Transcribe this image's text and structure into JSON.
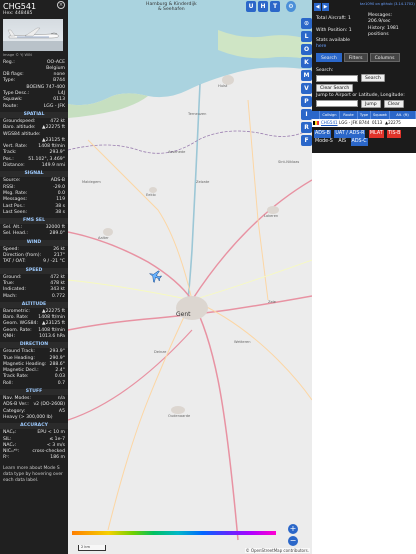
{
  "info": {
    "callsign": "CHG541",
    "hex_label": "Hex: 448485",
    "close": "×",
    "photo_credit": "Image © YJ WIN",
    "id_rows": [
      {
        "k": "Reg.:",
        "v": "OO-ACE"
      },
      {
        "k": "",
        "v": "Belgium"
      },
      {
        "k": "DB flags:",
        "v": "none"
      },
      {
        "k": "Type:",
        "v": "B744"
      },
      {
        "k": "",
        "v": "BOEING 747-400"
      },
      {
        "k": "Type Desc.:",
        "v": "L4J"
      },
      {
        "k": "Squawk:",
        "v": "0113"
      },
      {
        "k": "Route:",
        "v": "LGG - JFK"
      }
    ],
    "sections": [
      {
        "title": "SPATIAL",
        "rows": [
          {
            "k": "Groundspeed:",
            "v": "472 kt"
          },
          {
            "k": "Baro. altitude:",
            "v": "▲22275 ft"
          },
          {
            "k": "WGS84 altitude:",
            "v": ""
          },
          {
            "k": "",
            "v": "▲23125 ft"
          },
          {
            "k": "Vert. Rate:",
            "v": "1408 ft/min"
          },
          {
            "k": "Track:",
            "v": "293.9°"
          },
          {
            "k": "Pos.:",
            "v": "51.102°, 3.469°"
          },
          {
            "k": "Distance:",
            "v": "149.9 nmi"
          }
        ]
      },
      {
        "title": "SIGNAL",
        "rows": [
          {
            "k": "Source:",
            "v": "ADS-B"
          },
          {
            "k": "RSSI:",
            "v": "-29.0"
          },
          {
            "k": "Msg. Rate:",
            "v": "0.0"
          },
          {
            "k": "Messages:",
            "v": "119"
          },
          {
            "k": "Last Pos.:",
            "v": "38 s"
          },
          {
            "k": "Last Seen:",
            "v": "38 s"
          }
        ]
      },
      {
        "title": "FMS SEL",
        "rows": [
          {
            "k": "Sel. Alt.:",
            "v": "32000 ft"
          },
          {
            "k": "Sel. Head.:",
            "v": "289.0°"
          }
        ]
      },
      {
        "title": "WIND",
        "rows": [
          {
            "k": "Speed:",
            "v": "26 kt"
          },
          {
            "k": "Direction (from):",
            "v": "217°"
          },
          {
            "k": "TAT / OAT:",
            "v": "9 / -21 °C"
          }
        ]
      },
      {
        "title": "SPEED",
        "rows": [
          {
            "k": "Ground:",
            "v": "472 kt"
          },
          {
            "k": "True:",
            "v": "478 kt"
          },
          {
            "k": "Indicated:",
            "v": "343 kt"
          },
          {
            "k": "Mach:",
            "v": "0.772"
          }
        ]
      },
      {
        "title": "ALTITUDE",
        "rows": [
          {
            "k": "Barometric:",
            "v": "▲22275 ft"
          },
          {
            "k": "Baro. Rate:",
            "v": "1408 ft/min"
          },
          {
            "k": "Geom. WGS84:",
            "v": "▲23125 ft"
          },
          {
            "k": "Geom. Rate:",
            "v": "1408 ft/min"
          },
          {
            "k": "QNH:",
            "v": "1013.6 hPa"
          }
        ]
      },
      {
        "title": "DIRECTION",
        "rows": [
          {
            "k": "Ground Track:",
            "v": "293.9°"
          },
          {
            "k": "True Heading:",
            "v": "290.9°"
          },
          {
            "k": "Magnetic Heading:",
            "v": "288.6°"
          },
          {
            "k": "Magnetic Decl.:",
            "v": "2.4°"
          },
          {
            "k": "Track Rate:",
            "v": "0.03"
          },
          {
            "k": "Roll:",
            "v": "0.7"
          }
        ]
      },
      {
        "title": "STUFF",
        "rows": [
          {
            "k": "Nav. Modes:",
            "v": "n/a"
          },
          {
            "k": "ADS-B Ver.:",
            "v": "v2 (DO-260B)"
          },
          {
            "k": "Category:",
            "v": "A5"
          },
          {
            "k": "Heavy (> 300,000 lb)",
            "v": ""
          }
        ]
      },
      {
        "title": "ACCURACY",
        "rows": [
          {
            "k": "NACₚ:",
            "v": "EPU < 10 m"
          },
          {
            "k": "SIL:",
            "v": "≤ 1e-7"
          },
          {
            "k": "NACᵥ:",
            "v": "< 3 m/s"
          },
          {
            "k": "NICₒᵢᵉᵇ:",
            "v": "cross-checked"
          },
          {
            "k": "Rᶜ:",
            "v": "186 m"
          }
        ]
      }
    ],
    "note": "Learn more about Mode S data type by hovering over each data label."
  },
  "map": {
    "top_label_line1": "Hamburg & Kinderdijk",
    "top_label_line2": "& Seehafen",
    "layer_buttons": [
      "U",
      "H",
      "T"
    ],
    "side_buttons": [
      "⊙",
      "L",
      "O",
      "K",
      "M",
      "V",
      "P",
      "I",
      "R",
      "F"
    ],
    "cities": [
      "Gent",
      "Aalter",
      "Eeklo",
      "Lokeren",
      "Deinze",
      "Oudenaarde",
      "Hulst",
      "Terneuzen",
      "Sint-Niklaas",
      "Zelzate",
      "Wetteren",
      "Zele",
      "Assenede",
      "Maldegem"
    ],
    "zoom_in": "+",
    "zoom_out": "−",
    "scale_label": "2 km",
    "attribution": "© OpenStreetMap contributors.",
    "plane_color": "#69b4ff"
  },
  "sidebar": {
    "version_link": "tar1090 on github (3.14.1702)",
    "stats": {
      "total_label": "Total Aircraft: 1",
      "messages_label": "Messages:",
      "messages_value": "206.9/sec",
      "with_pos_label": "With Position: 1",
      "history_label": "History: 1981",
      "history_value": "positions",
      "stats_available": "Stats available",
      "here": "here"
    },
    "tabs": [
      "Search",
      "Filters",
      "Columns"
    ],
    "search": {
      "label": "Search:",
      "button": "Search",
      "clear_button": "Clear Search",
      "jump_label": "Jump to Airport or Latitude, Longitude:",
      "jump_button": "Jump",
      "clear2": "Clear"
    },
    "table": {
      "headers": [
        "Callsign",
        "Route",
        "Type",
        "Squawk",
        "Alt. (ft)"
      ],
      "rows": [
        {
          "flag": "BE",
          "callsign": "CHG541",
          "route": "LGG - JFK",
          "type": "B744",
          "squawk": "0113",
          "alt": "▲22275"
        }
      ]
    },
    "legend": [
      "ADS-B",
      "UAT / ADS-R",
      "MLAT",
      "TIS-B",
      "Mode-S",
      "AIS",
      "ADS-C"
    ],
    "legend_colors": {
      "adsb": "#2b67c9",
      "mlat": "#e0332a"
    }
  }
}
